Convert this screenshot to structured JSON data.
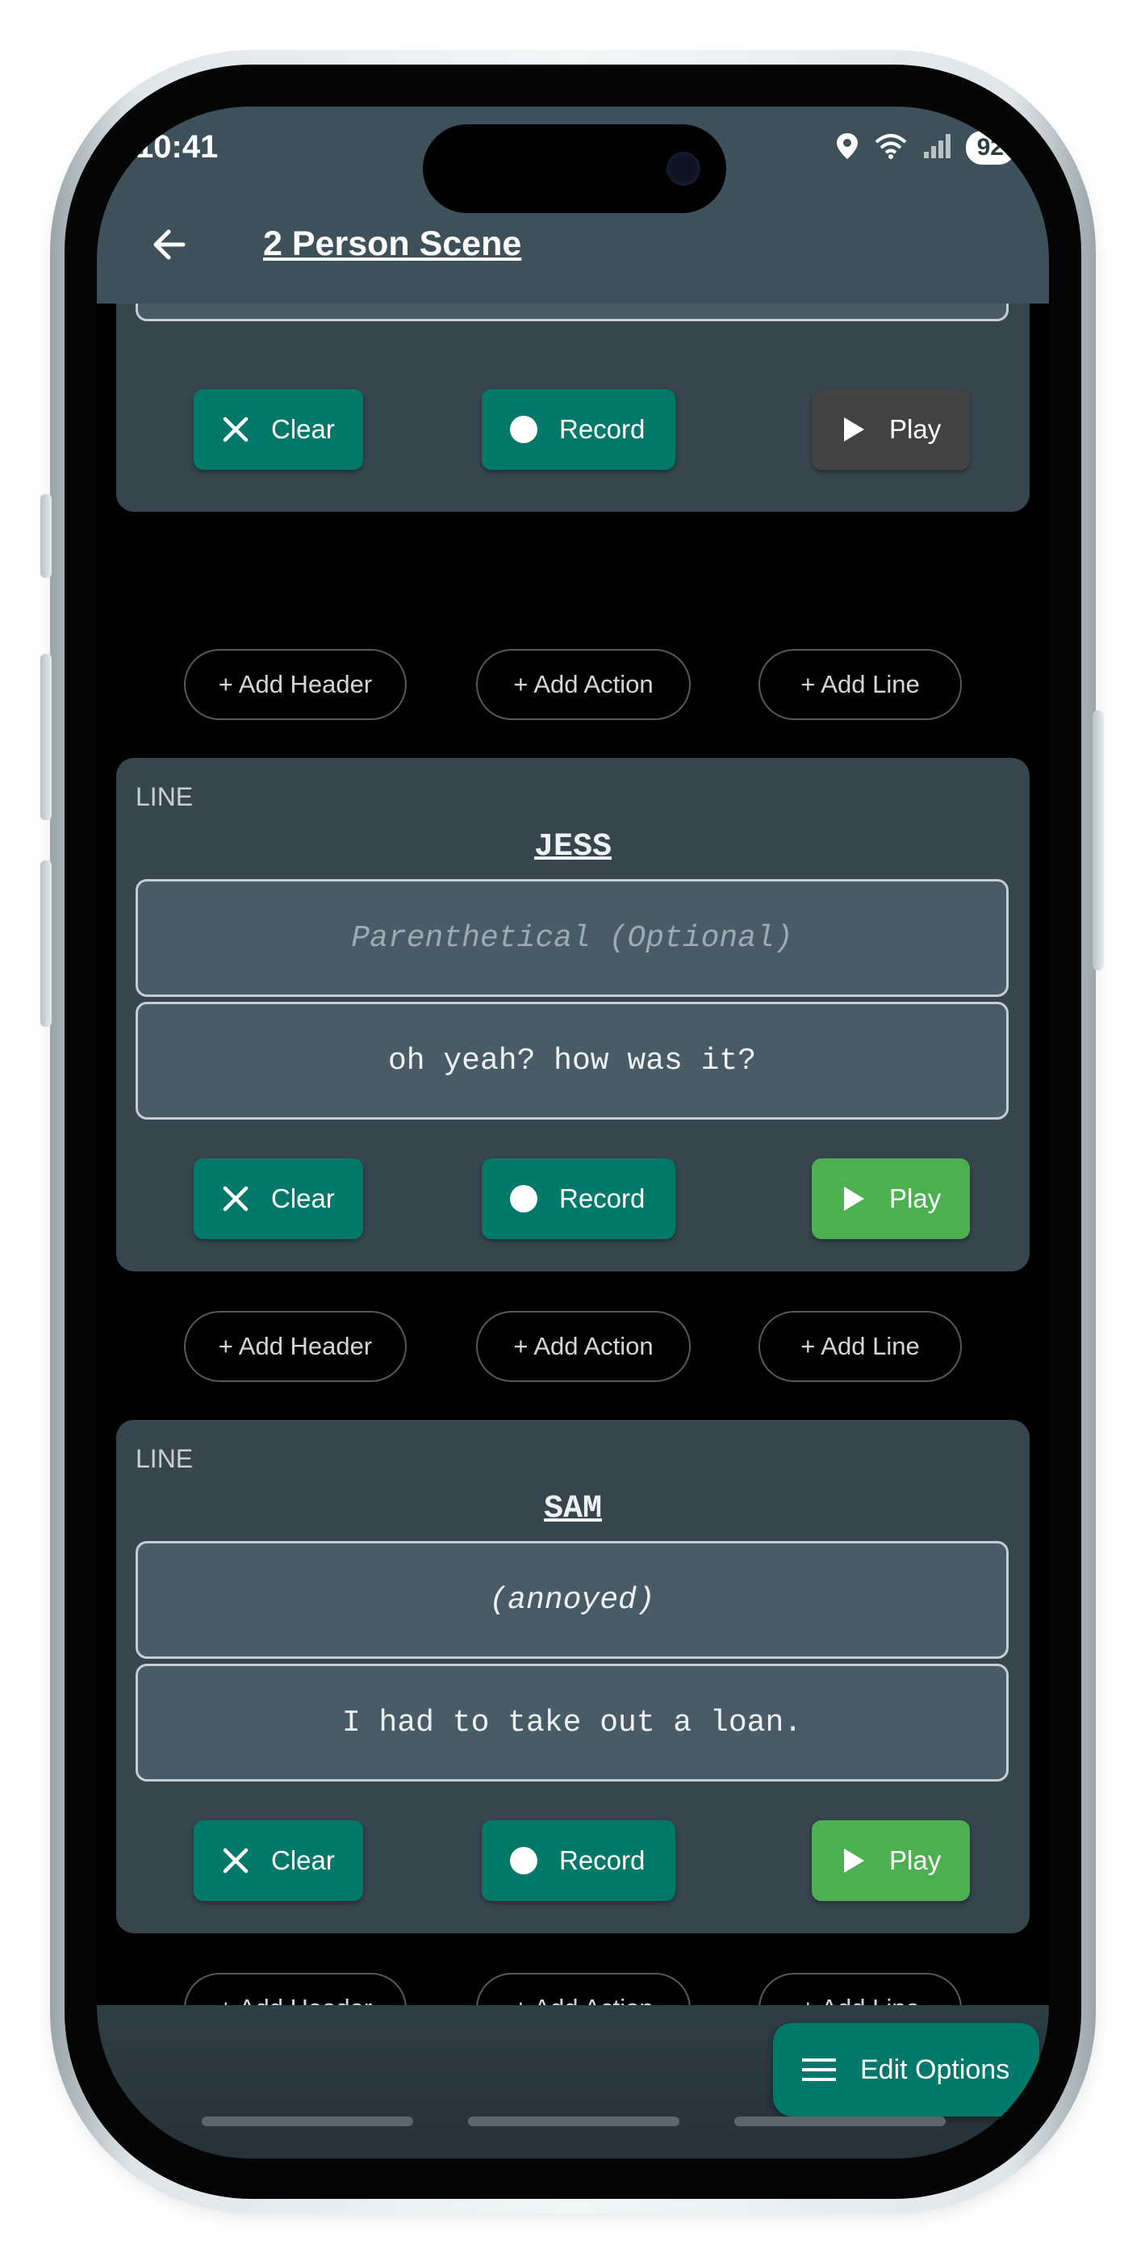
{
  "status": {
    "time": "10:41",
    "battery": "92"
  },
  "appbar": {
    "title": "2 Person Scene"
  },
  "blocks": [
    {
      "clear_label": "Clear",
      "record_label": "Record",
      "play_label": "Play"
    },
    {
      "tag": "LINE",
      "character": "JESS",
      "parenthetical_placeholder": "Parenthetical (Optional)",
      "dialogue": "oh yeah? how was it?",
      "clear_label": "Clear",
      "record_label": "Record",
      "play_label": "Play"
    },
    {
      "tag": "LINE",
      "character": "SAM",
      "parenthetical": "(annoyed)",
      "dialogue": "I had to take out a loan.",
      "clear_label": "Clear",
      "record_label": "Record",
      "play_label": "Play"
    }
  ],
  "add_row": {
    "header_label": "+ Add Header",
    "action_label": "+ Add Action",
    "line_label": "+ Add Line"
  },
  "fab": {
    "label": "Edit Options"
  },
  "colors": {
    "appbar": "#3e515b",
    "card": "#36454e",
    "teal_button": "#00796b",
    "play_enabled": "#4caf50",
    "play_disabled": "#424242"
  },
  "icons": {
    "back": "arrow-left-icon",
    "clear": "close-icon",
    "record": "record-circle-icon",
    "play": "play-icon",
    "menu": "menu-icon"
  }
}
